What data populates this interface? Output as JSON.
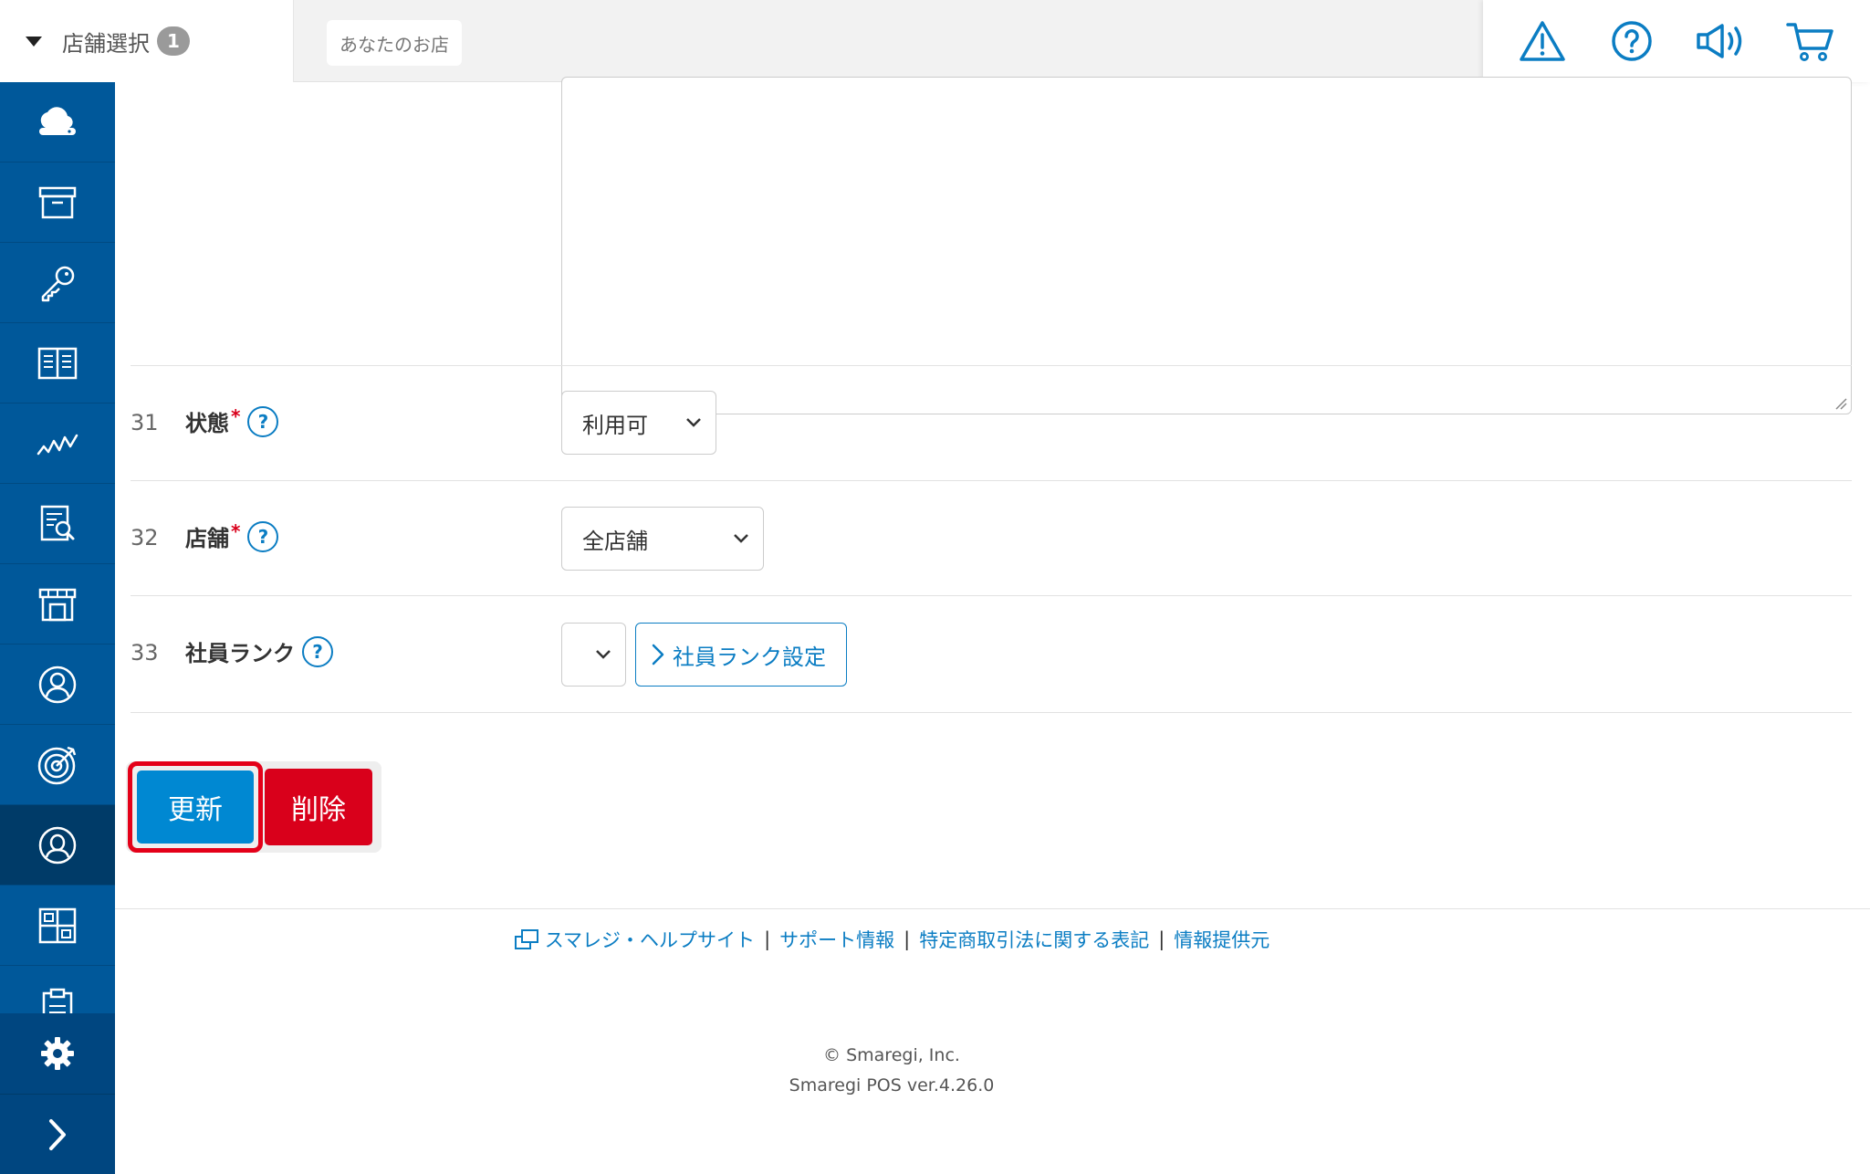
{
  "header": {
    "store_select_label": "店舗選択",
    "store_count": "1",
    "store_chip": "あなたのお店",
    "icons": [
      "warning-icon",
      "help-icon",
      "megaphone-icon",
      "cart-icon"
    ]
  },
  "sidebar": {
    "items": [
      "cloud-icon",
      "archive-icon",
      "key-icon",
      "book-icon",
      "chart-line-icon",
      "report-search-icon",
      "store-icon",
      "customer-icon",
      "target-icon",
      "staff-icon",
      "grid-icon",
      "clipboard-icon"
    ],
    "active_item": "staff-icon",
    "bottom": [
      "gear-icon",
      "chevron-right-icon"
    ]
  },
  "form": {
    "rows": [
      {
        "num": "31",
        "label": "状態",
        "required": "*",
        "help": "?",
        "select_value": "利用可"
      },
      {
        "num": "32",
        "label": "店舗",
        "required": "*",
        "help": "?",
        "select_value": "全店舗"
      },
      {
        "num": "33",
        "label": "社員ランク",
        "help": "?",
        "select_value": "",
        "link_button": "社員ランク設定"
      }
    ]
  },
  "actions": {
    "update_label": "更新",
    "delete_label": "削除"
  },
  "footer": {
    "links": [
      "スマレジ・ヘルプサイト",
      "サポート情報",
      "特定商取引法に関する表記",
      "情報提供元"
    ],
    "separator": "|",
    "copyright": "© Smaregi, Inc.",
    "version": "Smaregi POS ver.4.26.0"
  },
  "colors": {
    "sidebar": "#00589a",
    "sidebar_active": "#003b68",
    "primary": "#0088d2",
    "link": "#0b7dc3",
    "danger": "#d9001b",
    "highlight": "#e40019"
  }
}
